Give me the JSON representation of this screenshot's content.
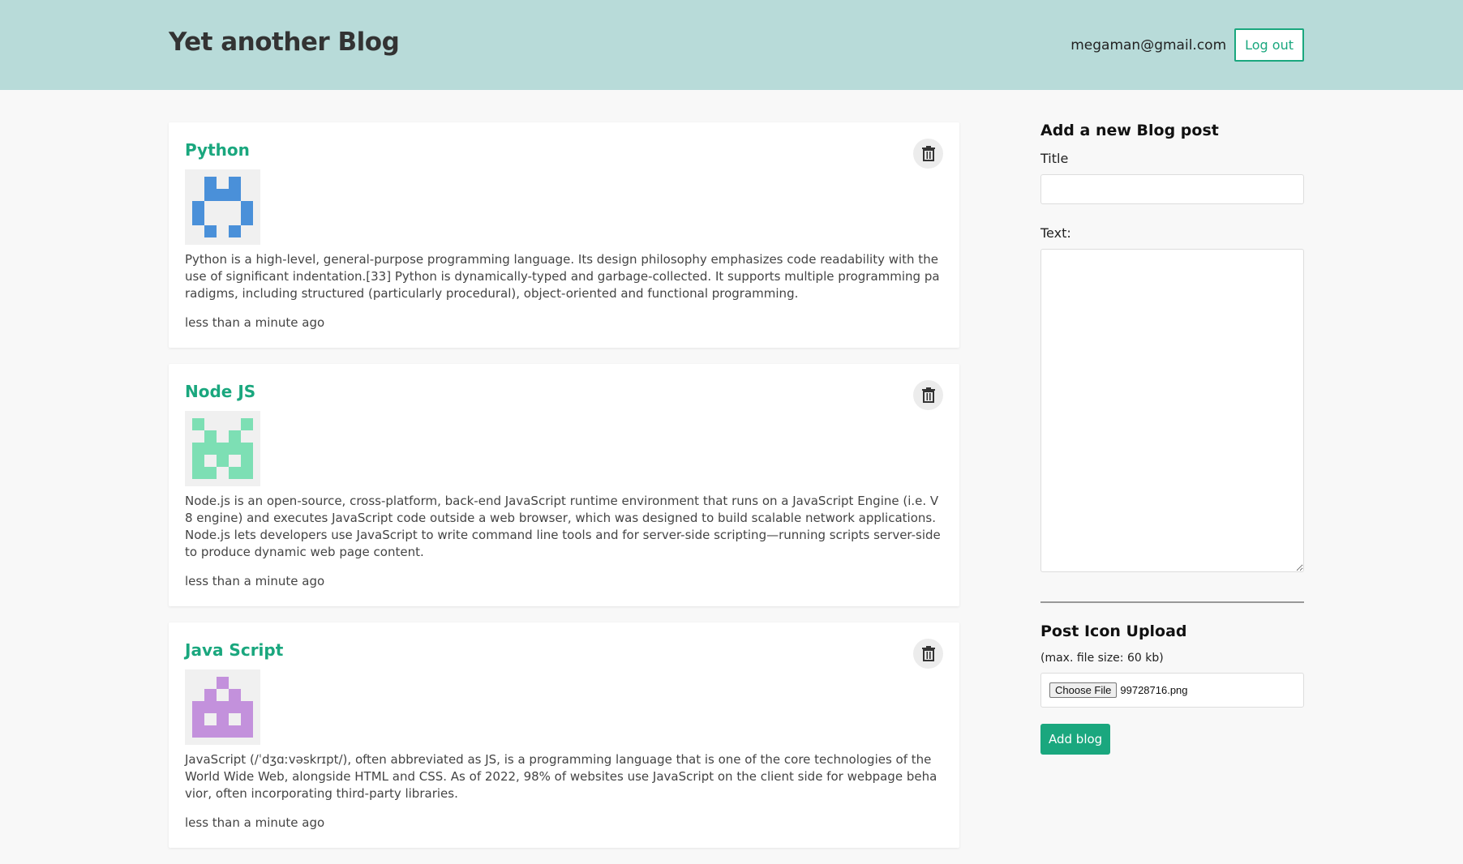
{
  "header": {
    "site_title": "Yet another Blog",
    "user_email": "megaman@gmail.com",
    "logout_label": "Log out"
  },
  "posts": [
    {
      "title": "Python",
      "icon_color": "#4a90d9",
      "icon_pattern": [
        0,
        1,
        0,
        1,
        0,
        0,
        1,
        1,
        1,
        0,
        1,
        0,
        0,
        0,
        1,
        1,
        0,
        0,
        0,
        1,
        0,
        1,
        0,
        1,
        0
      ],
      "text": "Python is a high-level, general-purpose programming language. Its design philosophy emphasizes code readability with the use of significant indentation.[33] Python is dynamically-typed and garbage-collected. It supports multiple programming paradigms, including structured (particularly procedural), object-oriented and functional programming.",
      "time": "less than a minute ago"
    },
    {
      "title": "Node JS",
      "icon_color": "#7ddfb4",
      "icon_pattern": [
        1,
        0,
        0,
        0,
        1,
        0,
        1,
        0,
        1,
        0,
        1,
        1,
        1,
        1,
        1,
        1,
        0,
        1,
        0,
        1,
        1,
        1,
        0,
        1,
        1
      ],
      "text": "Node.js is an open-source, cross-platform, back-end JavaScript runtime environment that runs on a JavaScript Engine (i.e. V8 engine) and executes JavaScript code outside a web browser, which was designed to build scalable network applications. Node.js lets developers use JavaScript to write command line tools and for server-side scripting—running scripts server-side to produce dynamic web page content.",
      "time": "less than a minute ago"
    },
    {
      "title": "Java Script",
      "icon_color": "#c391dc",
      "icon_pattern": [
        0,
        0,
        1,
        0,
        0,
        0,
        1,
        0,
        1,
        0,
        1,
        1,
        1,
        1,
        1,
        1,
        0,
        1,
        0,
        1,
        1,
        1,
        1,
        1,
        1
      ],
      "text": "JavaScript (/ˈdʒɑːvəskrɪpt/), often abbreviated as JS, is a programming language that is one of the core technologies of the World Wide Web, alongside HTML and CSS. As of 2022, 98% of websites use JavaScript on the client side for webpage behavior, often incorporating third-party libraries.",
      "time": "less than a minute ago"
    }
  ],
  "sidebar": {
    "heading": "Add a new Blog post",
    "title_label": "Title",
    "text_label": "Text:",
    "upload_heading": "Post Icon Upload",
    "upload_note": "(max. file size: 60 kb)",
    "choose_file_label": "Choose File",
    "file_name": "99728716.png",
    "add_blog_label": "Add blog"
  }
}
